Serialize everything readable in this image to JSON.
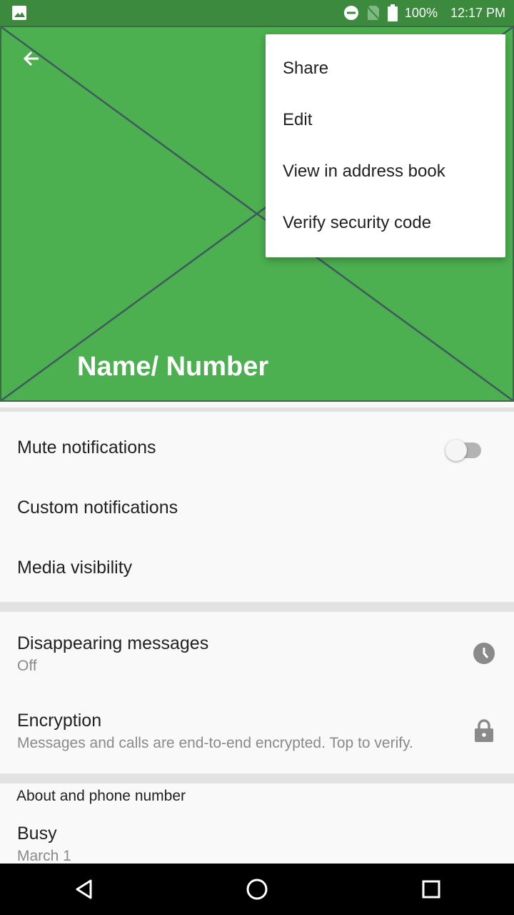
{
  "status_bar": {
    "battery_percent": "100%",
    "time": "12:17 PM",
    "icons": [
      "image-icon",
      "do-not-disturb-icon",
      "no-sim-icon",
      "battery-icon"
    ]
  },
  "header": {
    "contact_name": "Name/ Number",
    "placeholder_image": "image-placeholder-x",
    "background_color": "#4caf50"
  },
  "overflow_menu": {
    "items": [
      {
        "label": "Share"
      },
      {
        "label": "Edit"
      },
      {
        "label": "View in address book"
      },
      {
        "label": "Verify security code"
      }
    ]
  },
  "notifications": {
    "mute": {
      "label": "Mute notifications",
      "enabled": false
    },
    "custom": {
      "label": "Custom notifications"
    },
    "media": {
      "label": "Media visibility"
    }
  },
  "privacy": {
    "disappearing": {
      "title": "Disappearing messages",
      "subtitle": "Off",
      "icon": "timer-icon"
    },
    "encryption": {
      "title": "Encryption",
      "subtitle": "Messages and calls are end-to-end encrypted. Top to verify.",
      "icon": "lock-icon"
    }
  },
  "about": {
    "section_label": "About and phone number",
    "status": "Busy",
    "date": "March 1"
  },
  "nav_bar": {
    "buttons": [
      "back-icon",
      "home-icon",
      "recents-icon"
    ]
  }
}
